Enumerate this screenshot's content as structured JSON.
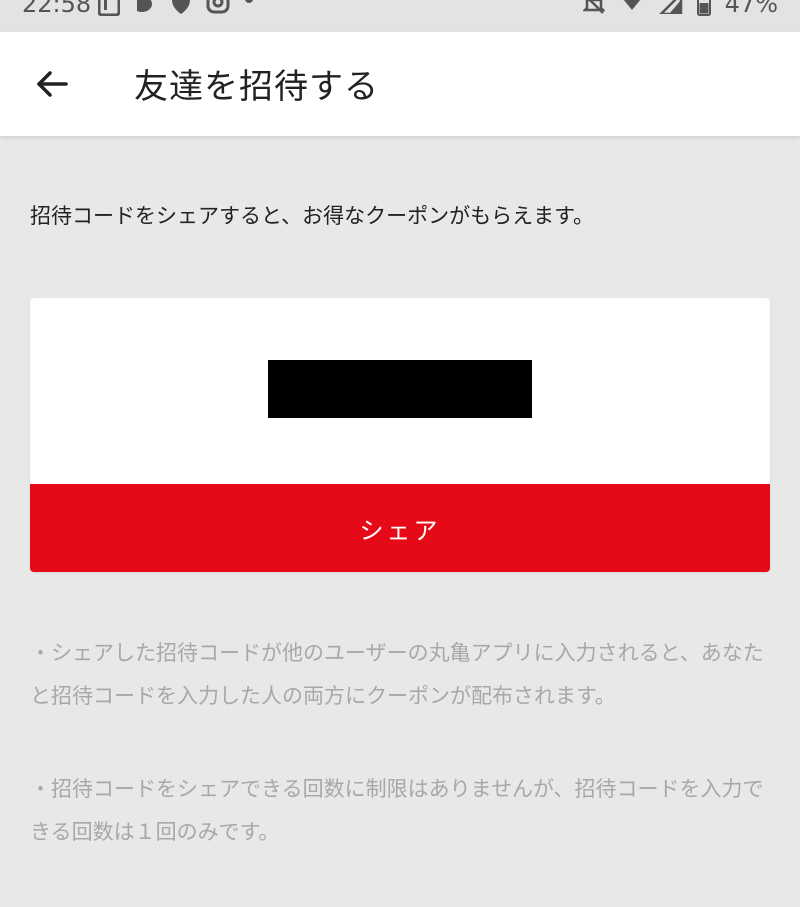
{
  "status_bar": {
    "time": "22:58",
    "battery": "47%",
    "icons_left": [
      "linkedin-icon",
      "app-icon",
      "shield-icon",
      "instagram-icon",
      "dot-icon"
    ],
    "icons_right": [
      "notifications-off-icon",
      "wifi-icon",
      "signal-icon",
      "battery-icon"
    ]
  },
  "header": {
    "back_icon": "arrow-left-icon",
    "title": "友達を招待する"
  },
  "main": {
    "intro": "招待コードをシェアすると、お得なクーポンがもらえます。",
    "invite_code": "",
    "share_label": "シェア",
    "notes": [
      "・シェアした招待コードが他のユーザーの丸亀アプリに入力されると、あなたと招待コードを入力した人の両方にクーポンが配布されます。",
      "・招待コードをシェアできる回数に制限はありませんが、招待コードを入力できる回数は１回のみです。"
    ]
  },
  "colors": {
    "accent": "#e60a18",
    "background": "#e8e8e8",
    "note_text": "#a8a8a8"
  }
}
